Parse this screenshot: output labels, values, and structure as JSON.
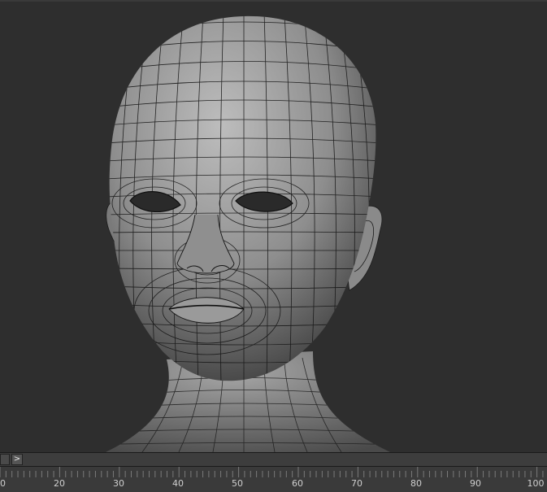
{
  "viewport": {
    "subject": "3D head mesh with wireframe overlay"
  },
  "time_slider": {
    "next_label": ">"
  },
  "trackbar": {
    "start": 10,
    "end": 100,
    "major_step": 10,
    "labels": [
      "0",
      "20",
      "30",
      "40",
      "50",
      "60",
      "70",
      "80",
      "90",
      "100"
    ]
  }
}
